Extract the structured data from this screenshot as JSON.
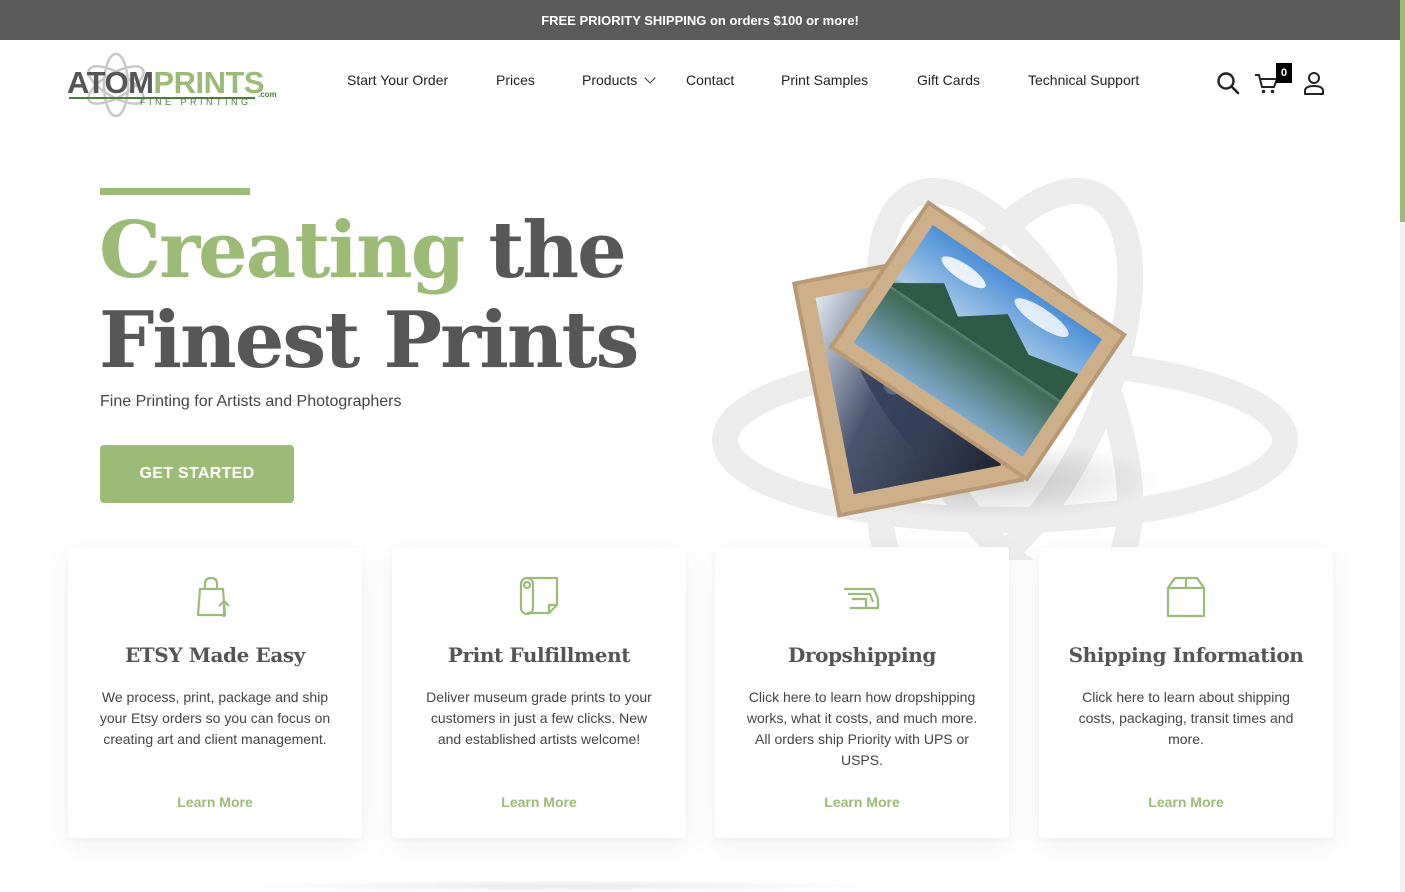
{
  "promo": {
    "text": "FREE PRIORITY SHIPPING on orders $100 or more!"
  },
  "logo": {
    "atom": "ATOM",
    "prints": "PRINTS",
    "sub": "FINE PRINTING",
    "com": ".com"
  },
  "nav": {
    "items": [
      {
        "label": "Start Your Order"
      },
      {
        "label": "Prices"
      },
      {
        "label": "Products"
      },
      {
        "label": "Contact"
      },
      {
        "label": "Print Samples"
      },
      {
        "label": "Gift Cards"
      },
      {
        "label": "Technical Support"
      }
    ]
  },
  "header_icons": {
    "search": "search-icon",
    "cart": "cart-icon",
    "account": "user-icon",
    "cart_count": "0"
  },
  "hero": {
    "title_green": "Creating",
    "title_rest_line1": " the",
    "title_line2": "Finest Prints",
    "subtitle": "Fine Printing for Artists and Photographers",
    "cta": "GET STARTED"
  },
  "cards": [
    {
      "icon": "shopping-bag-icon",
      "title": "ETSY Made Easy",
      "desc": "We process, print, package and ship your Etsy orders so you can focus on creating art and client management.",
      "link": "Learn More"
    },
    {
      "icon": "print-roll-icon",
      "title": "Print Fulfillment",
      "desc": "Deliver museum grade prints to your customers in just a few clicks. New and established artists welcome!",
      "link": "Learn More"
    },
    {
      "icon": "shipping-truck-icon",
      "title": "Dropshipping",
      "desc": "Click here to learn how dropshipping works, what it costs, and much more. All orders ship Priority with UPS or USPS.",
      "link": "Learn More"
    },
    {
      "icon": "box-icon",
      "title": "Shipping Information",
      "desc": "Click here to learn about shipping costs, packaging, transit times and more.",
      "link": "Learn More"
    }
  ],
  "colors": {
    "brand_green": "#9bbb76",
    "dark_green": "#4d7d3b",
    "dark_gray": "#575757",
    "promo_bg": "#5b5b5b"
  }
}
